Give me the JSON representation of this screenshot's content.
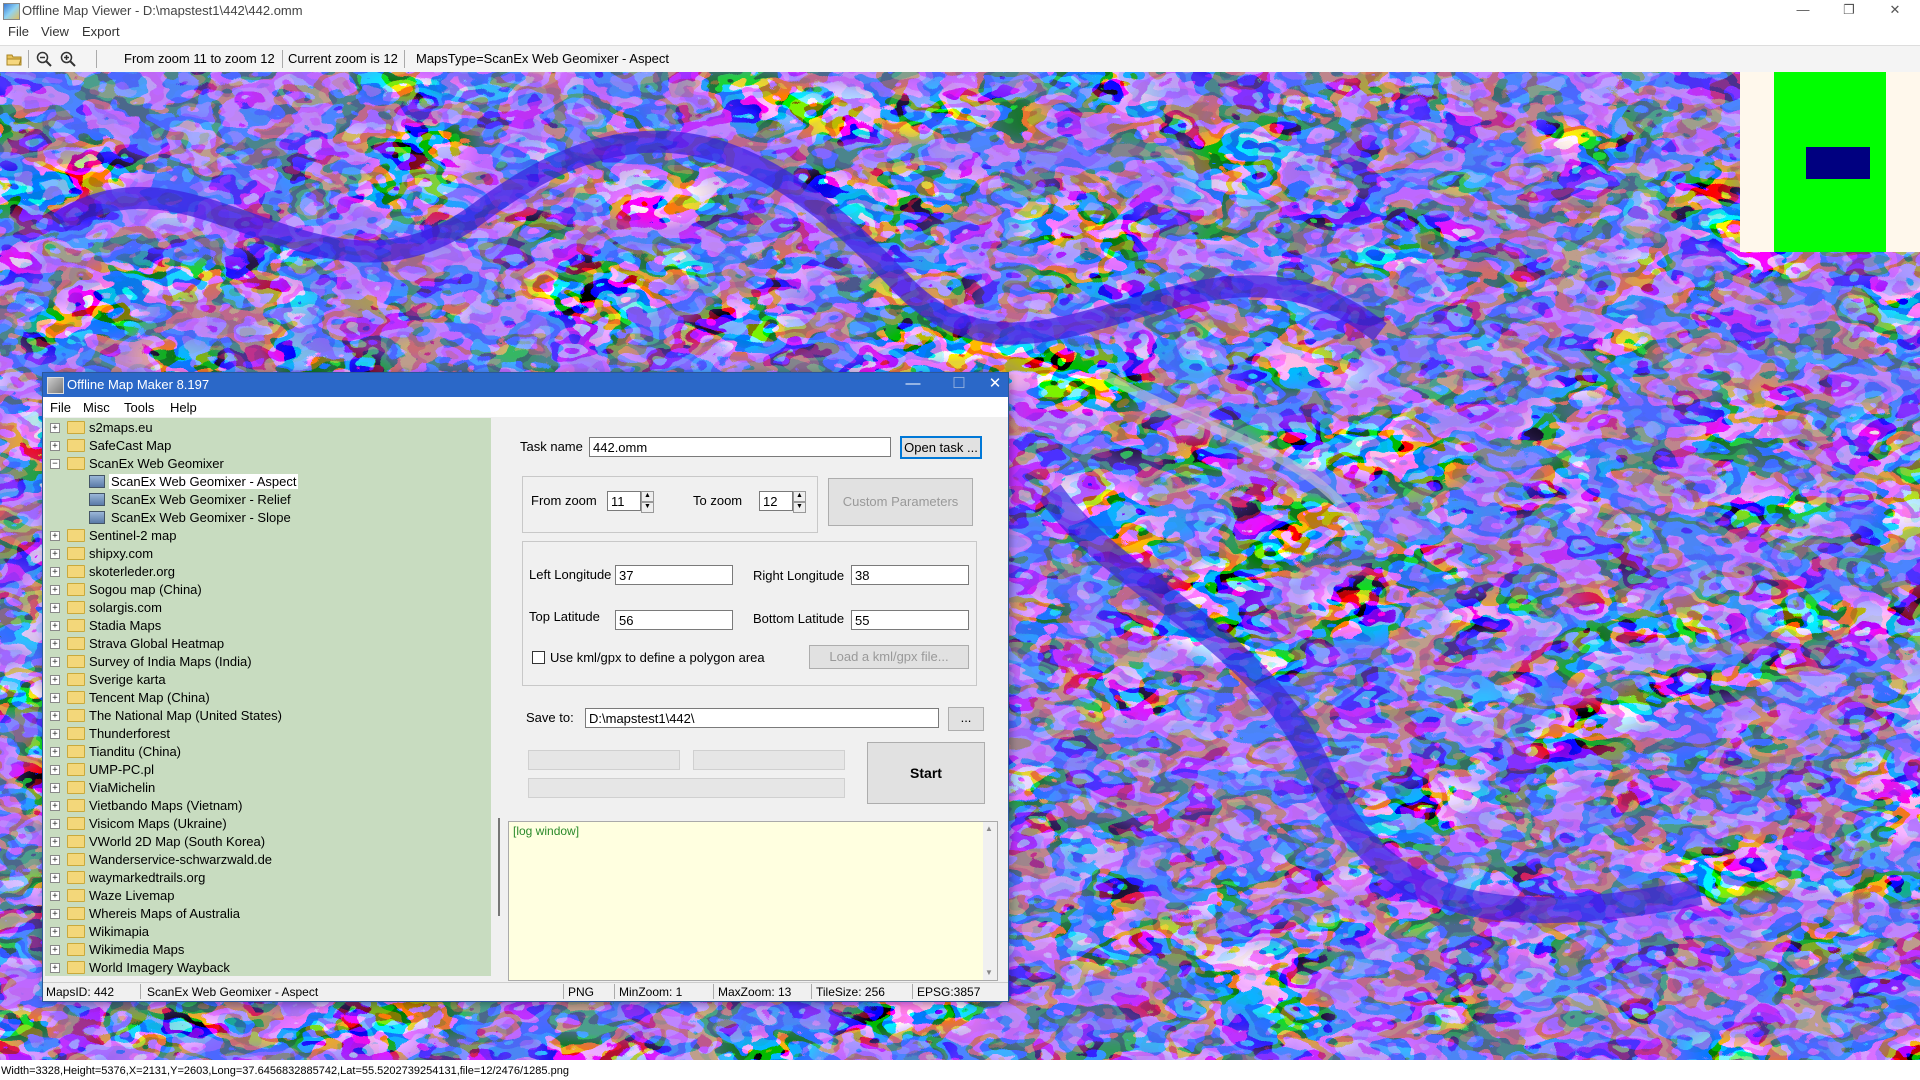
{
  "window": {
    "title": "Offline Map Viewer - D:\\mapstest1\\442\\442.omm",
    "minimize": "—",
    "maximize": "❐",
    "close": "✕"
  },
  "menu": [
    "File",
    "View",
    "Export"
  ],
  "toolbar": {
    "zoom_range": "From zoom 11 to zoom 12",
    "current_zoom": "Current zoom is 12",
    "maps_type": "MapsType=ScanEx Web Geomixer - Aspect",
    "icons": [
      "folder-open-icon",
      "zoom-out-icon",
      "zoom-in-icon"
    ]
  },
  "status_bar": "Width=3328,Height=5376,X=2131,Y=2603,Long=37.6456832885742,Lat=55.5202739254131,file=12/2476/1285.png",
  "minimap": {
    "colors": {
      "background": "#fff8ec",
      "area": "#00ff00",
      "viewport": "#000080"
    }
  },
  "dialog": {
    "title": "Offline Map Maker 8.197",
    "menu": [
      "File",
      "Misc",
      "Tools",
      "Help"
    ],
    "tree": [
      {
        "label": "s2maps.eu",
        "type": "folder"
      },
      {
        "label": "SafeCast Map",
        "type": "folder"
      },
      {
        "label": "ScanEx Web Geomixer",
        "type": "folder",
        "expanded": true
      },
      {
        "label": "ScanEx Web Geomixer - Aspect",
        "type": "map",
        "selected": true
      },
      {
        "label": "ScanEx Web Geomixer - Relief",
        "type": "map"
      },
      {
        "label": "ScanEx Web Geomixer - Slope",
        "type": "map"
      },
      {
        "label": "Sentinel-2 map",
        "type": "folder"
      },
      {
        "label": "shipxy.com",
        "type": "folder"
      },
      {
        "label": "skoterleder.org",
        "type": "folder"
      },
      {
        "label": "Sogou map (China)",
        "type": "folder"
      },
      {
        "label": "solargis.com",
        "type": "folder"
      },
      {
        "label": "Stadia Maps",
        "type": "folder"
      },
      {
        "label": "Strava Global Heatmap",
        "type": "folder"
      },
      {
        "label": "Survey of India Maps (India)",
        "type": "folder"
      },
      {
        "label": "Sverige karta",
        "type": "folder"
      },
      {
        "label": "Tencent Map (China)",
        "type": "folder"
      },
      {
        "label": "The National Map (United States)",
        "type": "folder"
      },
      {
        "label": "Thunderforest",
        "type": "folder"
      },
      {
        "label": "Tianditu (China)",
        "type": "folder"
      },
      {
        "label": "UMP-PC.pl",
        "type": "folder"
      },
      {
        "label": "ViaMichelin",
        "type": "folder"
      },
      {
        "label": "Vietbando Maps (Vietnam)",
        "type": "folder"
      },
      {
        "label": "Visicom Maps (Ukraine)",
        "type": "folder"
      },
      {
        "label": "VWorld 2D Map (South Korea)",
        "type": "folder"
      },
      {
        "label": "Wanderservice-schwarzwald.de",
        "type": "folder"
      },
      {
        "label": "waymarkedtrails.org",
        "type": "folder"
      },
      {
        "label": "Waze Livemap",
        "type": "folder"
      },
      {
        "label": "Whereis Maps of Australia",
        "type": "folder"
      },
      {
        "label": "Wikimapia",
        "type": "folder"
      },
      {
        "label": "Wikimedia Maps",
        "type": "folder"
      },
      {
        "label": "World Imagery Wayback",
        "type": "folder"
      }
    ],
    "task": {
      "label": "Task name",
      "value": "442.omm",
      "open_button": "Open task ..."
    },
    "zoom": {
      "from_label": "From zoom",
      "from_value": "11",
      "to_label": "To zoom",
      "to_value": "12",
      "custom_button": "Custom Parameters"
    },
    "coords": {
      "left_lon_label": "Left Longitude",
      "left_lon": "37",
      "right_lon_label": "Right Longitude",
      "right_lon": "38",
      "top_lat_label": "Top Latitude",
      "top_lat": "56",
      "bottom_lat_label": "Bottom Latitude",
      "bottom_lat": "55",
      "kml_checkbox": "Use kml/gpx to define a polygon area",
      "kml_button": "Load a kml/gpx file..."
    },
    "save": {
      "label": "Save to:",
      "value": "D:\\mapstest1\\442\\",
      "browse": "..."
    },
    "start_button": "Start",
    "log": "[log window]",
    "status": {
      "maps_id": "MapsID: 442",
      "maps_name": "ScanEx Web Geomixer - Aspect",
      "format": "PNG",
      "min_zoom": "MinZoom: 1",
      "max_zoom": "MaxZoom: 13",
      "tile_size": "TileSize: 256",
      "epsg": "EPSG:3857"
    }
  }
}
